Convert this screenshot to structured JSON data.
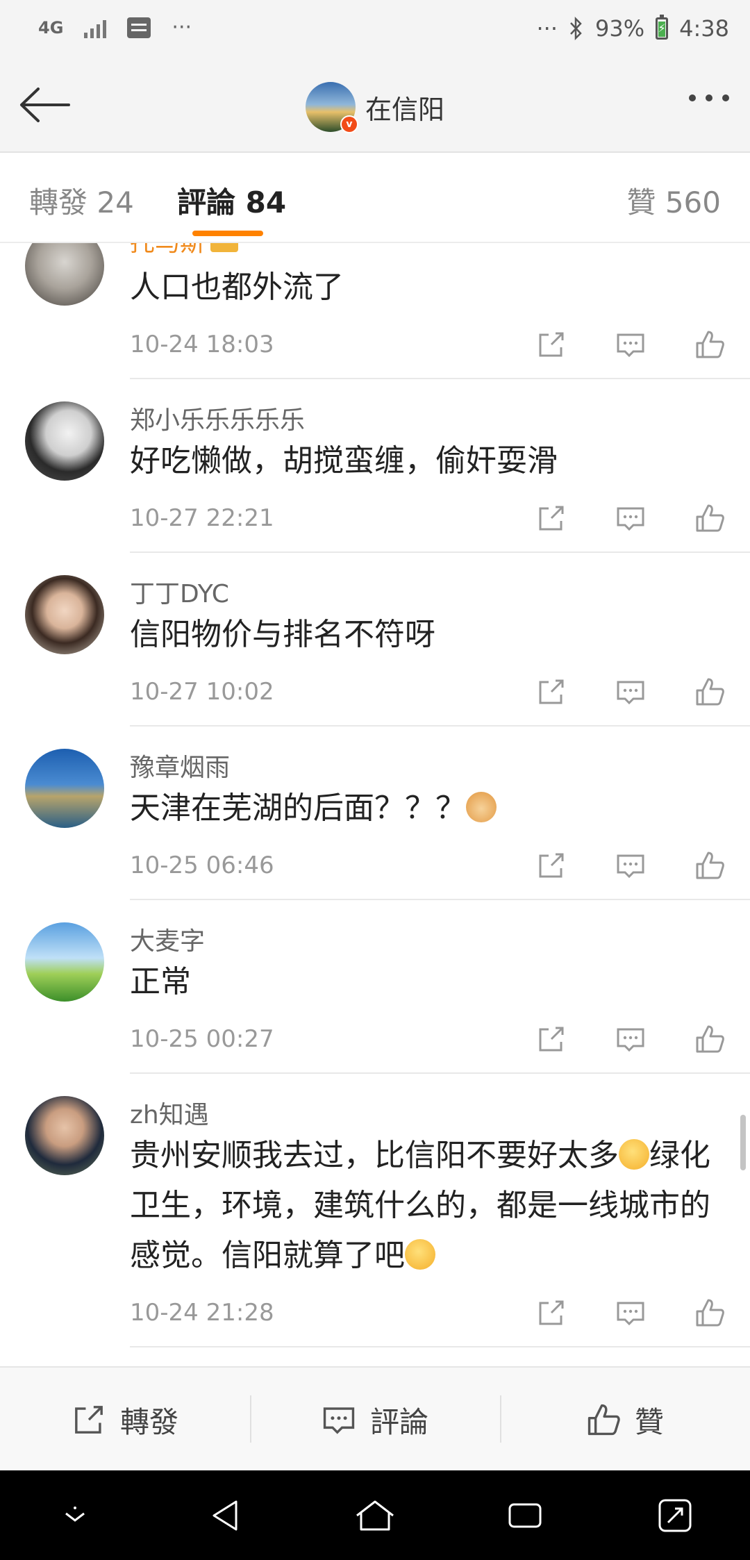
{
  "status_bar": {
    "network": "4G",
    "overflow": "···",
    "right_overflow": "···",
    "battery": "93%",
    "time": "4:38"
  },
  "header": {
    "title": "在信阳"
  },
  "tabs": {
    "repost": "轉發 24",
    "comment": "評論 84",
    "like": "贊 560"
  },
  "comments": [
    {
      "username": "托马斯",
      "text": "人口也都外流了",
      "time": "10-24 18:03"
    },
    {
      "username": "郑小乐乐乐乐乐",
      "text": "好吃懒做，胡搅蛮缠，偷奸耍滑",
      "time": "10-27 22:21"
    },
    {
      "username": "丁丁DYC",
      "text": "信阳物价与排名不符呀",
      "time": "10-27 10:02"
    },
    {
      "username": "豫章烟雨",
      "text": "天津在芜湖的后面？？？",
      "time": "10-25 06:46"
    },
    {
      "username": "大麦字",
      "text": "正常",
      "time": "10-25 00:27"
    },
    {
      "username": "zh知遇",
      "text_parts": [
        "贵州安顺我去过，比信阳不要好太多",
        "绿化卫生，环境，建筑什么的，都是一线城市的感觉。信阳就算了吧"
      ],
      "time": "10-24 21:28"
    }
  ],
  "bottom_bar": {
    "repost": "轉發",
    "comment": "評論",
    "like": "贊"
  },
  "icons": {
    "back": "arrow-left-icon",
    "more": "more-dots-icon",
    "share": "share-icon",
    "comment": "comment-icon",
    "like": "thumb-up-icon"
  },
  "colors": {
    "accent": "#ff8200",
    "verified_badge": "#f24c18",
    "timestamp": "#999999",
    "username": "#666666"
  }
}
